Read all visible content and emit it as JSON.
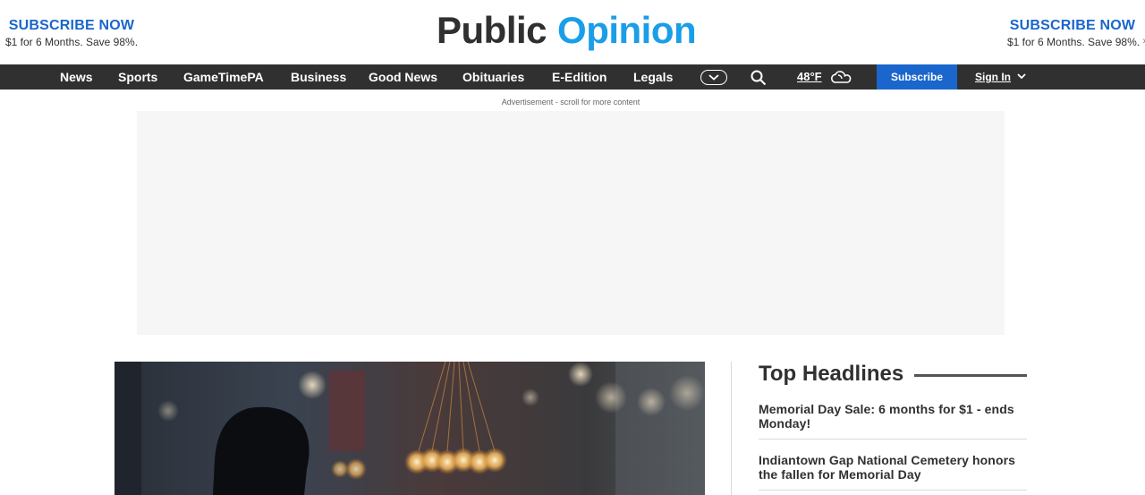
{
  "promo": {
    "left": {
      "title": "SUBSCRIBE NOW",
      "subtitle": "$1 for 6 Months. Save 98%."
    },
    "right": {
      "title": "SUBSCRIBE NOW",
      "subtitle": "$1 for 6 Months. Save 98%."
    }
  },
  "logo": {
    "word1": "Public",
    "word2": "Opinion"
  },
  "nav": {
    "items": [
      "News",
      "Sports",
      "GameTimePA",
      "Business",
      "Good News",
      "Obituaries",
      "E-Edition",
      "Legals"
    ],
    "more_icon": "chevron-down-icon",
    "search_icon": "search-icon",
    "weather": {
      "temp": "48°F",
      "icon": "cloud-icon"
    },
    "subscribe_label": "Subscribe",
    "signin_label": "Sign In"
  },
  "ad": {
    "label": "Advertisement - scroll for more content"
  },
  "headlines": {
    "title": "Top Headlines",
    "items": [
      "Memorial Day Sale: 6 months for $1 - ends Monday!",
      "Indiantown Gap National Cemetery honors the fallen for Memorial Day"
    ]
  },
  "colors": {
    "brand_blue": "#1a66cc",
    "logo_blue": "#1a9ee8",
    "nav_bg": "#303030"
  }
}
